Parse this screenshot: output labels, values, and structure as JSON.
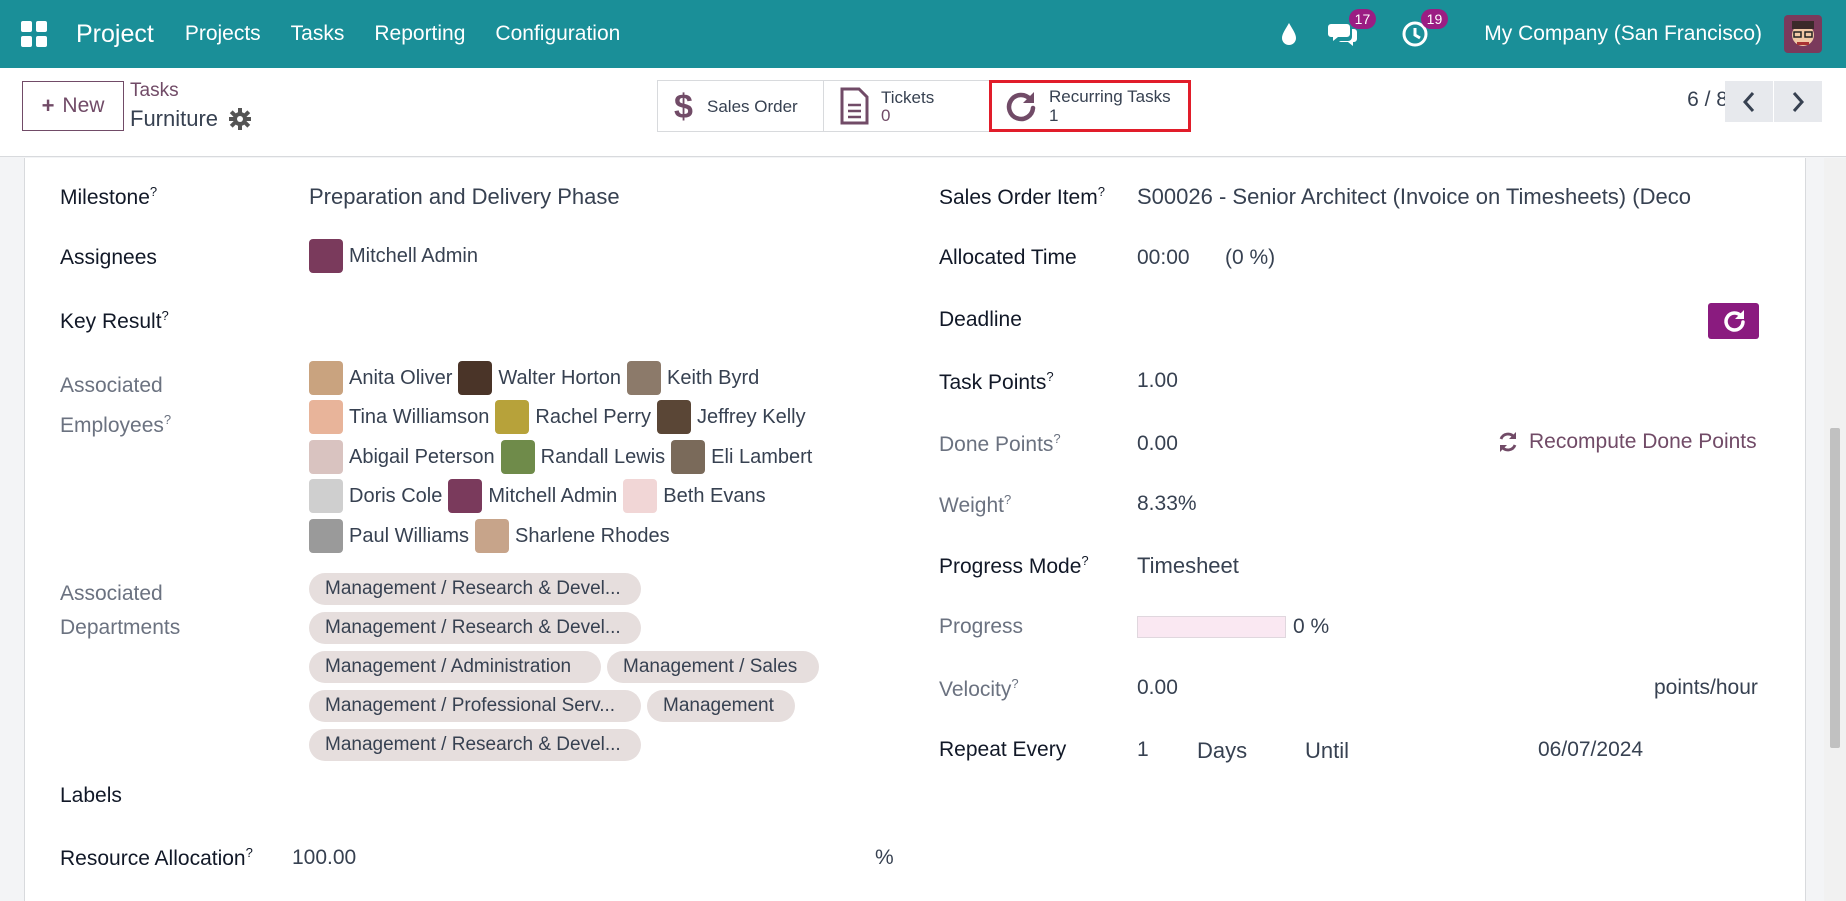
{
  "navbar": {
    "brand": "Project",
    "menu": [
      "Projects",
      "Tasks",
      "Reporting",
      "Configuration"
    ],
    "messages_count": "17",
    "activities_count": "19",
    "company": "My Company (San Francisco)"
  },
  "control": {
    "new_label": "New",
    "breadcrumb_parent": "Tasks",
    "breadcrumb_current": "Furniture",
    "smart_buttons": {
      "sales_order": "Sales Order",
      "tickets": "Tickets",
      "tickets_count": "0",
      "recurring": "Recurring Tasks",
      "recurring_count": "1"
    },
    "pager": "6 / 8"
  },
  "form": {
    "left": {
      "milestone_label": "Milestone",
      "milestone_value": "Preparation and Delivery Phase",
      "assignees_label": "Assignees",
      "assignee": "Mitchell Admin",
      "key_result_label": "Key Result",
      "associated_employees_label_1": "Associated",
      "associated_employees_label_2": "Employees",
      "employees": [
        [
          "Anita Oliver",
          "Walter Horton",
          "Keith Byrd"
        ],
        [
          "Tina Williamson",
          "Rachel Perry",
          "Jeffrey Kelly"
        ],
        [
          "Abigail Peterson",
          "Randall Lewis",
          "Eli Lambert"
        ],
        [
          "Doris Cole",
          "Mitchell Admin",
          "Beth Evans"
        ],
        [
          "Paul Williams",
          "Sharlene Rhodes"
        ]
      ],
      "associated_departments_label_1": "Associated",
      "associated_departments_label_2": "Departments",
      "departments": [
        "Management / Research & Devel...",
        "Management / Research & Devel...",
        "Management / Administration",
        "Management / Sales",
        "Management / Professional Serv...",
        "Management",
        "Management / Research & Devel..."
      ],
      "labels_label": "Labels",
      "resource_allocation_label": "Resource Allocation",
      "resource_allocation_value": "100.00",
      "resource_allocation_unit": "%"
    },
    "right": {
      "sales_order_item_label": "Sales Order Item",
      "sales_order_item_value": "S00026 - Senior Architect (Invoice on Timesheets) (Deco",
      "allocated_time_label": "Allocated Time",
      "allocated_time_value": "00:00",
      "allocated_time_pct": "(0 %)",
      "deadline_label": "Deadline",
      "task_points_label": "Task Points",
      "task_points_value": "1.00",
      "done_points_label": "Done Points",
      "done_points_value": "0.00",
      "recompute_label": "Recompute Done Points",
      "weight_label": "Weight",
      "weight_value": "8.33%",
      "progress_mode_label": "Progress Mode",
      "progress_mode_value": "Timesheet",
      "progress_label": "Progress",
      "progress_fraction": 0,
      "progress_value": "0 %",
      "velocity_label": "Velocity",
      "velocity_value": "0.00",
      "velocity_unit": "points/hour",
      "repeat_every_label": "Repeat Every",
      "repeat_every_value": "1",
      "repeat_unit": "Days",
      "repeat_type": "Until",
      "repeat_until": "06/07/2024"
    },
    "help_mark": "?"
  },
  "colors": {
    "navbar": "#1a8f98",
    "primary": "#714b67",
    "badge": "#9b1d83",
    "highlight": "#e11d2a"
  }
}
